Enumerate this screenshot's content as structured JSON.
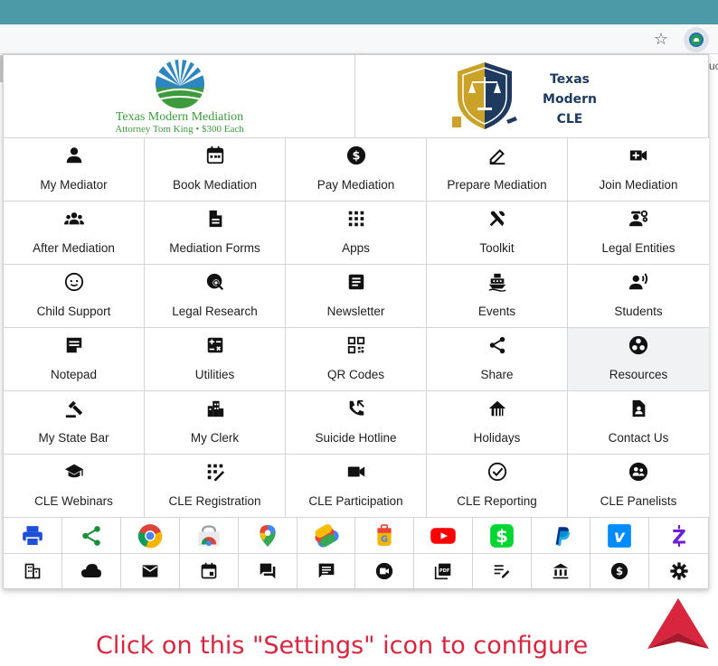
{
  "browser": {
    "edge_text": "uc"
  },
  "header": {
    "left_title": "Texas Modern Mediation",
    "left_subtitle": "Attorney Tom King • $300 Each",
    "right_line1": "Texas",
    "right_line2": "Modern",
    "right_line3": "CLE"
  },
  "grid": [
    {
      "label": "My Mediator",
      "icon": "person-icon"
    },
    {
      "label": "Book Mediation",
      "icon": "calendar-icon"
    },
    {
      "label": "Pay Mediation",
      "icon": "dollar-circle-icon"
    },
    {
      "label": "Prepare Mediation",
      "icon": "pen-edit-icon"
    },
    {
      "label": "Join Mediation",
      "icon": "video-add-icon"
    },
    {
      "label": "After Mediation",
      "icon": "group-icon"
    },
    {
      "label": "Mediation Forms",
      "icon": "document-icon"
    },
    {
      "label": "Apps",
      "icon": "apps-grid-icon"
    },
    {
      "label": "Toolkit",
      "icon": "tools-icon"
    },
    {
      "label": "Legal Entities",
      "icon": "engineering-icon"
    },
    {
      "label": "Child Support",
      "icon": "child-face-icon"
    },
    {
      "label": "Legal Research",
      "icon": "globe-search-icon"
    },
    {
      "label": "Newsletter",
      "icon": "article-icon"
    },
    {
      "label": "Events",
      "icon": "cruise-ship-icon"
    },
    {
      "label": "Students",
      "icon": "record-voice-icon"
    },
    {
      "label": "Notepad",
      "icon": "sticky-note-icon"
    },
    {
      "label": "Utilities",
      "icon": "calculator-icon"
    },
    {
      "label": "QR Codes",
      "icon": "qr-code-icon"
    },
    {
      "label": "Share",
      "icon": "share-icon"
    },
    {
      "label": "Resources",
      "icon": "workspaces-icon"
    },
    {
      "label": "My State Bar",
      "icon": "gavel-icon"
    },
    {
      "label": "My Clerk",
      "icon": "city-building-icon"
    },
    {
      "label": "Suicide Hotline",
      "icon": "phone-forwarded-icon"
    },
    {
      "label": "Holidays",
      "icon": "house-siding-icon"
    },
    {
      "label": "Contact Us",
      "icon": "contact-page-icon"
    },
    {
      "label": "CLE Webinars",
      "icon": "graduation-cap-icon"
    },
    {
      "label": "CLE Registration",
      "icon": "app-registration-icon"
    },
    {
      "label": "CLE Participation",
      "icon": "videocam-icon"
    },
    {
      "label": "CLE Reporting",
      "icon": "check-circle-icon"
    },
    {
      "label": "CLE Panelists",
      "icon": "groups-circle-icon"
    }
  ],
  "apps": [
    "printer-icon",
    "share-green-icon",
    "chrome-icon",
    "chrome-web-store-icon",
    "google-maps-icon",
    "google-pay-icon",
    "google-trips-icon",
    "youtube-icon",
    "cash-app-icon",
    "paypal-icon",
    "venmo-icon",
    "zelle-icon"
  ],
  "utilities": [
    "domain-icon",
    "cloud-icon",
    "mail-icon",
    "event-icon",
    "forum-icon",
    "chat-icon",
    "video-chat-icon",
    "pdf-icon",
    "edit-note-icon",
    "bank-icon",
    "dollar-icon",
    "settings-icon"
  ],
  "colors": {
    "caption": "#d7263d",
    "topbar": "#4a9aa7",
    "sun_green": "#3d9b3d",
    "sun_blue": "#2e86c1"
  },
  "caption": "Click on this \"Settings\" icon to configure"
}
